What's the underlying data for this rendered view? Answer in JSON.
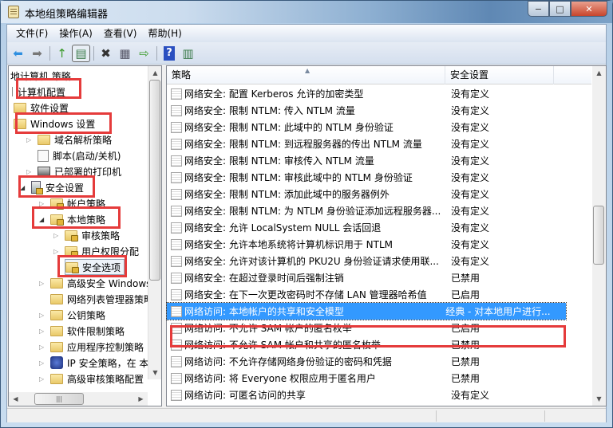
{
  "window": {
    "title": "本地组策略编辑器",
    "min": "−",
    "max": "□",
    "close": "✕"
  },
  "menu": [
    "文件(F)",
    "操作(A)",
    "查看(V)",
    "帮助(H)"
  ],
  "toolbar": {
    "back": "⬅",
    "forward": "➡",
    "up": "↑",
    "show_tree": "▤",
    "delete": "✖",
    "properties": "▦",
    "export": "⇨",
    "help": "?",
    "show_action": "▥"
  },
  "tree": {
    "header": "地计算机 策略",
    "items": [
      {
        "label": "计算机配置"
      },
      {
        "label": "软件设置"
      },
      {
        "label": "Windows 设置"
      },
      {
        "label": "域名解析策略"
      },
      {
        "label": "脚本(启动/关机)"
      },
      {
        "label": "已部署的打印机"
      },
      {
        "label": "安全设置"
      },
      {
        "label": "帐户策略"
      },
      {
        "label": "本地策略"
      },
      {
        "label": "审核策略"
      },
      {
        "label": "用户权限分配"
      },
      {
        "label": "安全选项"
      },
      {
        "label": "高级安全 Windows"
      },
      {
        "label": "网络列表管理器策略"
      },
      {
        "label": "公钥策略"
      },
      {
        "label": "软件限制策略"
      },
      {
        "label": "应用程序控制策略"
      },
      {
        "label": "IP 安全策略，在 本地"
      },
      {
        "label": "高级审核策略配置"
      }
    ]
  },
  "list": {
    "columns": [
      "策略",
      "安全设置"
    ],
    "rows": [
      {
        "policy": "网络安全: 配置 Kerberos 允许的加密类型",
        "setting": "没有定义"
      },
      {
        "policy": "网络安全: 限制 NTLM: 传入 NTLM 流量",
        "setting": "没有定义"
      },
      {
        "policy": "网络安全: 限制 NTLM: 此域中的 NTLM 身份验证",
        "setting": "没有定义"
      },
      {
        "policy": "网络安全: 限制 NTLM: 到远程服务器的传出 NTLM 流量",
        "setting": "没有定义"
      },
      {
        "policy": "网络安全: 限制 NTLM: 审核传入 NTLM 流量",
        "setting": "没有定义"
      },
      {
        "policy": "网络安全: 限制 NTLM: 审核此域中的 NTLM 身份验证",
        "setting": "没有定义"
      },
      {
        "policy": "网络安全: 限制 NTLM: 添加此域中的服务器例外",
        "setting": "没有定义"
      },
      {
        "policy": "网络安全: 限制 NTLM: 为 NTLM 身份验证添加远程服务器...",
        "setting": "没有定义"
      },
      {
        "policy": "网络安全: 允许 LocalSystem NULL 会话回退",
        "setting": "没有定义"
      },
      {
        "policy": "网络安全: 允许本地系统将计算机标识用于 NTLM",
        "setting": "没有定义"
      },
      {
        "policy": "网络安全: 允许对该计算机的 PKU2U 身份验证请求使用联...",
        "setting": "没有定义"
      },
      {
        "policy": "网络安全: 在超过登录时间后强制注销",
        "setting": "已禁用"
      },
      {
        "policy": "网络安全: 在下一次更改密码时不存储 LAN 管理器哈希值",
        "setting": "已启用"
      },
      {
        "policy": "网络访问: 本地帐户的共享和安全模型",
        "setting": "经典 - 对本地用户进行..."
      },
      {
        "policy": "网络访问: 不允许 SAM 帐户的匿名枚举",
        "setting": "已启用"
      },
      {
        "policy": "网络访问: 不允许 SAM 帐户和共享的匿名枚举",
        "setting": "已禁用"
      },
      {
        "policy": "网络访问: 不允许存储网络身份验证的密码和凭据",
        "setting": "已禁用"
      },
      {
        "policy": "网络访问: 将 Everyone 权限应用于匿名用户",
        "setting": "已禁用"
      },
      {
        "policy": "网络访问: 可匿名访问的共享",
        "setting": "没有定义"
      }
    ],
    "selected_index": 13
  },
  "scroll": {
    "up": "▲",
    "down": "▼",
    "left": "◀",
    "right": "▶",
    "grip": "|||"
  }
}
